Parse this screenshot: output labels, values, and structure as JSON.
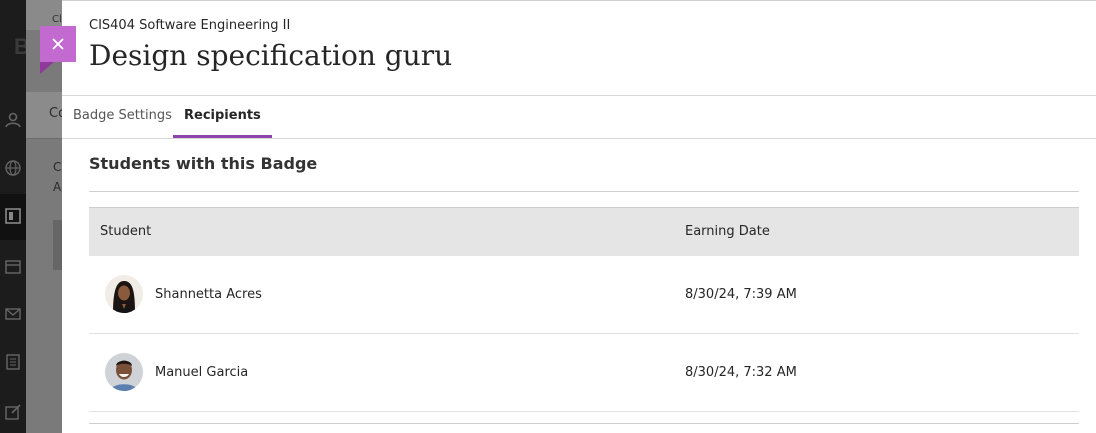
{
  "background": {
    "logo": "B",
    "tab_partial": "Co",
    "text_line_1": "C",
    "text_line_2": "A",
    "top_partial": "Cl"
  },
  "panel": {
    "course_name": "CIS404 Software Engineering II",
    "title": "Design specification guru",
    "close_icon": "close-icon"
  },
  "tabs": [
    {
      "label": "Badge Settings",
      "active": false
    },
    {
      "label": "Recipients",
      "active": true
    }
  ],
  "recipients": {
    "section_title": "Students with this Badge",
    "columns": [
      "Student",
      "Earning Date"
    ],
    "rows": [
      {
        "student": "Shannetta Acres",
        "earning_date": "8/30/24, 7:39 AM",
        "avatar": "avatar-photo"
      },
      {
        "student": "Manuel Garcia",
        "earning_date": "8/30/24, 7:32 AM",
        "avatar": "avatar-photo"
      }
    ]
  },
  "colors": {
    "accent": "#8e44ad",
    "close_flag": "#c36ad0"
  }
}
